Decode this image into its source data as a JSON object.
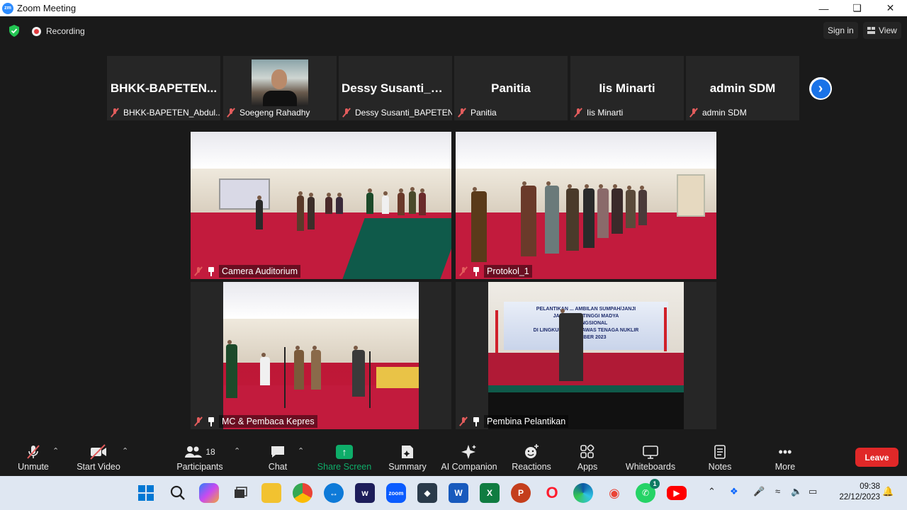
{
  "window": {
    "title": "Zoom Meeting",
    "logo": "zm"
  },
  "topbar": {
    "recording_label": "Recording",
    "sign_in": "Sign in",
    "view": "View"
  },
  "strip": [
    {
      "big_name": "BHKK-BAPETEN...",
      "footer": "BHKK-BAPETEN_Abdul..."
    },
    {
      "big_name": "",
      "footer": "Soegeng Rahadhy"
    },
    {
      "big_name": "Dessy  Susanti_B...",
      "footer": "Dessy Susanti_BAPETEN"
    },
    {
      "big_name": "Panitia",
      "footer": "Panitia"
    },
    {
      "big_name": "Iis Minarti",
      "footer": "Iis Minarti"
    },
    {
      "big_name": "admin SDM",
      "footer": "admin SDM"
    }
  ],
  "videos": [
    {
      "label": "Camera Auditorium"
    },
    {
      "label": "Protokol_1"
    },
    {
      "label": "MC & Pembaca Kepres"
    },
    {
      "label": "Pembina Pelantikan"
    }
  ],
  "banner_text": [
    "PELANTIKAN ... AMBILAN SUMPAH/JANJI",
    "JABAT... AN TINGGI MADYA",
    "...IV FUNGSIONAL",
    "DI LINGKUN... PENGAWAS TENAGA NUKLIR",
    "DESEMBER 2023"
  ],
  "toolbar": {
    "unmute": "Unmute",
    "start_video": "Start Video",
    "participants": "Participants",
    "participants_count": "18",
    "chat": "Chat",
    "share_screen": "Share Screen",
    "summary": "Summary",
    "ai_companion": "AI Companion",
    "reactions": "Reactions",
    "apps": "Apps",
    "whiteboards": "Whiteboards",
    "notes": "Notes",
    "more": "More",
    "leave": "Leave"
  },
  "taskbar": {
    "time": "09:38",
    "date": "22/12/2023",
    "whatsapp_badge": "1"
  },
  "colors": {
    "accent": "#2d8cff",
    "share": "#0ead69",
    "leave": "#e02828",
    "muted": "#e25c5c"
  }
}
